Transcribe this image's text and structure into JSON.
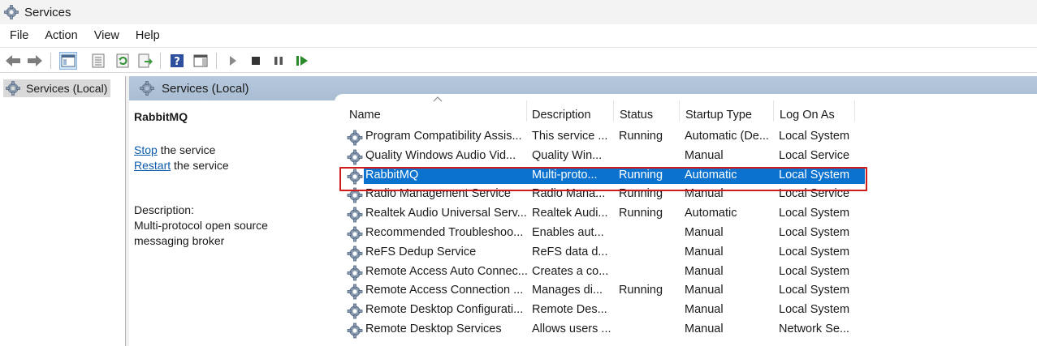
{
  "window": {
    "title": "Services",
    "icon": "services-gear-icon"
  },
  "menu": [
    "File",
    "Action",
    "View",
    "Help"
  ],
  "toolbar": {
    "buttons": [
      "back-arrow-icon",
      "forward-arrow-icon",
      "show-hide-console-tree-icon",
      "properties-icon",
      "refresh-icon",
      "export-list-icon",
      "help-icon",
      "show-action-pane-icon",
      "start-service-icon",
      "stop-service-icon",
      "pause-service-icon",
      "restart-service-icon"
    ]
  },
  "tree": {
    "root_label": "Services (Local)"
  },
  "pane_header": {
    "title": "Services (Local)"
  },
  "description_panel": {
    "service_name": "RabbitMQ",
    "stop_link": "Stop",
    "stop_suffix": " the service",
    "restart_link": "Restart",
    "restart_suffix": " the service",
    "description_label": "Description:",
    "description_line1": "Multi-protocol open source",
    "description_line2": "messaging broker"
  },
  "table": {
    "columns": [
      "Name",
      "Description",
      "Status",
      "Startup Type",
      "Log On As"
    ],
    "rows": [
      {
        "name": "Program Compatibility Assis...",
        "description": "This service ...",
        "status": "Running",
        "startup": "Automatic (De...",
        "logon": "Local System"
      },
      {
        "name": "Quality Windows Audio Vid...",
        "description": "Quality Win...",
        "status": "",
        "startup": "Manual",
        "logon": "Local Service"
      },
      {
        "name": "RabbitMQ",
        "description": "Multi-proto...",
        "status": "Running",
        "startup": "Automatic",
        "logon": "Local System",
        "selected": true
      },
      {
        "name": "Radio Management Service",
        "description": "Radio Mana...",
        "status": "Running",
        "startup": "Manual",
        "logon": "Local Service"
      },
      {
        "name": "Realtek Audio Universal Serv...",
        "description": "Realtek Audi...",
        "status": "Running",
        "startup": "Automatic",
        "logon": "Local System"
      },
      {
        "name": "Recommended Troubleshoo...",
        "description": "Enables aut...",
        "status": "",
        "startup": "Manual",
        "logon": "Local System"
      },
      {
        "name": "ReFS Dedup Service",
        "description": "ReFS data d...",
        "status": "",
        "startup": "Manual",
        "logon": "Local System"
      },
      {
        "name": "Remote Access Auto Connec...",
        "description": "Creates a co...",
        "status": "",
        "startup": "Manual",
        "logon": "Local System"
      },
      {
        "name": "Remote Access Connection ...",
        "description": "Manages di...",
        "status": "Running",
        "startup": "Manual",
        "logon": "Local System"
      },
      {
        "name": "Remote Desktop Configurati...",
        "description": "Remote Des...",
        "status": "",
        "startup": "Manual",
        "logon": "Local System"
      },
      {
        "name": "Remote Desktop Services",
        "description": "Allows users ...",
        "status": "",
        "startup": "Manual",
        "logon": "Network Se..."
      }
    ]
  },
  "colors": {
    "selection": "#0b73cf",
    "highlight_box": "#d11a1a",
    "link": "#0b5cad",
    "pane_header": "#b0c3d8"
  }
}
